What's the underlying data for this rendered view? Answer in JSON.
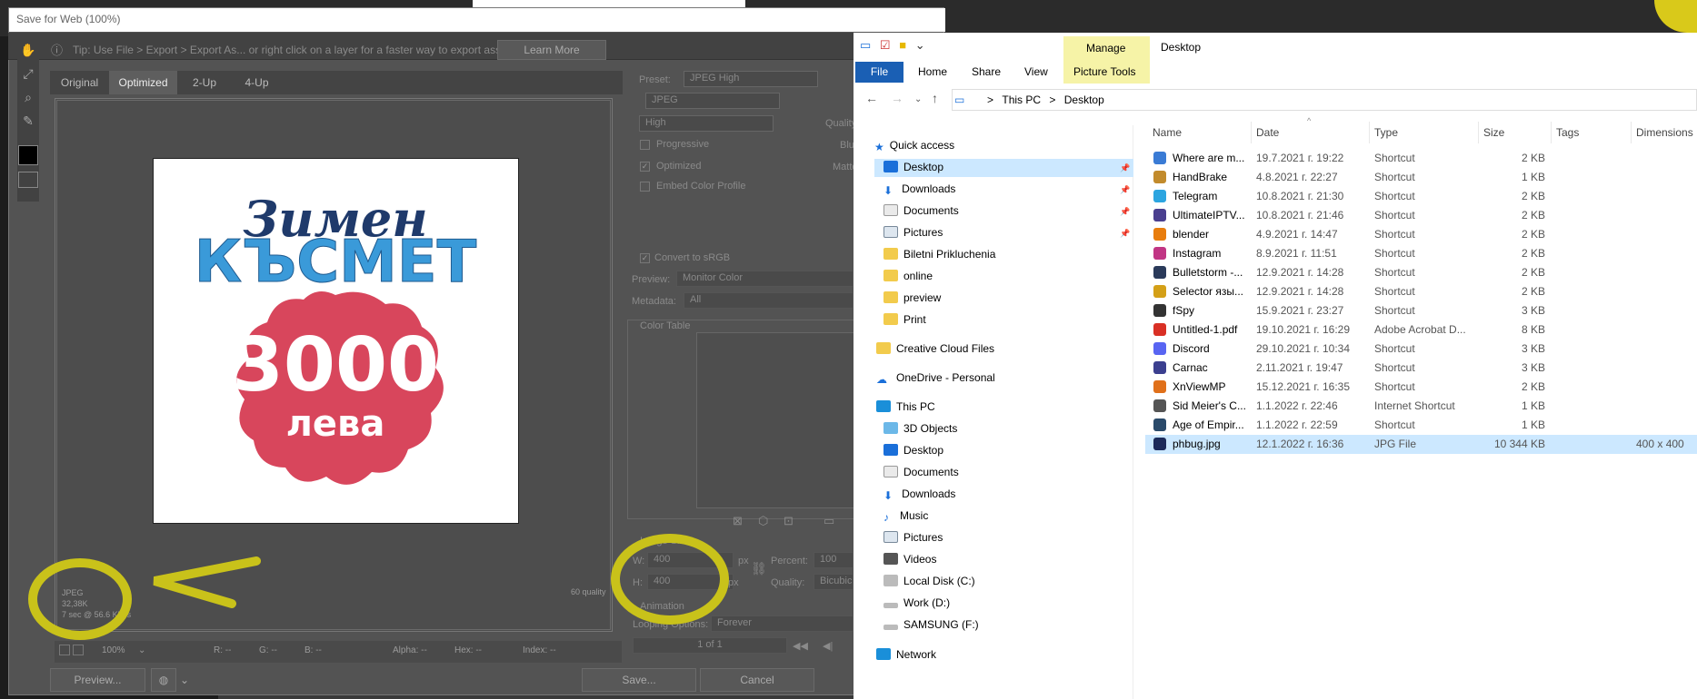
{
  "sfw": {
    "title": "Save for Web (100%)",
    "tip": "Tip: Use File > Export > Export As...  or right click on a layer for a faster way to export assets",
    "learn_more": "Learn More",
    "tabs": [
      "Original",
      "Optimized",
      "2-Up",
      "4-Up"
    ],
    "image_text": {
      "line1": "Зимен",
      "line2": "КЪСМЕТ",
      "amount": "3000",
      "currency": "лева"
    },
    "img_info": {
      "format": "JPEG",
      "size": "32,38K",
      "time": "7 sec @ 56.6 Kbps"
    },
    "quality_info": "60 quality",
    "status": {
      "zoom": "100%",
      "r": "R: --",
      "g": "G: --",
      "b": "B: --",
      "alpha": "Alpha: --",
      "hex": "Hex: --",
      "index": "Index: --"
    },
    "buttons": {
      "preview": "Preview...",
      "save": "Save...",
      "cancel": "Cancel"
    },
    "settings": {
      "preset_label": "Preset:",
      "preset_value": "JPEG High",
      "format": "JPEG",
      "quality_level": "High",
      "quality_label": "Quality:",
      "blur_label": "Blur:",
      "matte_label": "Matte:",
      "progressive": "Progressive",
      "optimized": "Optimized",
      "embed_profile": "Embed Color Profile",
      "convert_srgb": "Convert to sRGB",
      "preview_label": "Preview:",
      "preview_value": "Monitor Color",
      "metadata_label": "Metadata:",
      "metadata_value": "All",
      "color_table": "Color Table",
      "image_size": "Image Size",
      "w_label": "W:",
      "w_value": "400",
      "h_label": "H:",
      "h_value": "400",
      "px": "px",
      "percent_label": "Percent:",
      "percent_value": "100",
      "quality2_label": "Quality:",
      "quality2_value": "Bicubic",
      "animation": "Animation",
      "looping_label": "Looping Options:",
      "looping_value": "Forever",
      "frame": "1 of 1"
    }
  },
  "explorer": {
    "ribbon": {
      "manage": "Manage",
      "title": "Desktop",
      "picture_tools": "Picture Tools",
      "tabs": [
        "File",
        "Home",
        "Share",
        "View"
      ]
    },
    "address": {
      "pc": "This PC",
      "sep": ">",
      "folder": "Desktop"
    },
    "nav": {
      "quick_access": "Quick access",
      "desktop": "Desktop",
      "downloads": "Downloads",
      "documents": "Documents",
      "pictures": "Pictures",
      "biletni": "Biletni Prikluchenia",
      "online": "online",
      "preview": "preview",
      "print": "Print",
      "creative_cloud": "Creative Cloud Files",
      "onedrive": "OneDrive - Personal",
      "this_pc": "This PC",
      "objects3d": "3D Objects",
      "pc_desktop": "Desktop",
      "pc_documents": "Documents",
      "pc_downloads": "Downloads",
      "music": "Music",
      "pc_pictures": "Pictures",
      "videos": "Videos",
      "local_disk": "Local Disk (C:)",
      "work": "Work (D:)",
      "samsung": "SAMSUNG (F:)",
      "network": "Network"
    },
    "columns": [
      "Name",
      "Date",
      "Type",
      "Size",
      "Tags",
      "Dimensions"
    ],
    "files": [
      {
        "name": "Where are m...",
        "date": "19.7.2021 г. 19:22",
        "type": "Shortcut",
        "size": "2 KB",
        "dims": "",
        "color": "#3a7bd5"
      },
      {
        "name": "HandBrake",
        "date": "4.8.2021 г. 22:27",
        "type": "Shortcut",
        "size": "1 KB",
        "dims": "",
        "color": "#c28b2c"
      },
      {
        "name": "Telegram",
        "date": "10.8.2021 г. 21:30",
        "type": "Shortcut",
        "size": "2 KB",
        "dims": "",
        "color": "#2ca5e0"
      },
      {
        "name": "UltimateIPTV...",
        "date": "10.8.2021 г. 21:46",
        "type": "Shortcut",
        "size": "2 KB",
        "dims": "",
        "color": "#4a3f8f"
      },
      {
        "name": "blender",
        "date": "4.9.2021 г. 14:47",
        "type": "Shortcut",
        "size": "2 KB",
        "dims": "",
        "color": "#e87d0d"
      },
      {
        "name": "Instagram",
        "date": "8.9.2021 г. 11:51",
        "type": "Shortcut",
        "size": "2 KB",
        "dims": "",
        "color": "#c13584"
      },
      {
        "name": "Bulletstorm -...",
        "date": "12.9.2021 г. 14:28",
        "type": "Shortcut",
        "size": "2 KB",
        "dims": "",
        "color": "#2a3a5a"
      },
      {
        "name": "Selector язы...",
        "date": "12.9.2021 г. 14:28",
        "type": "Shortcut",
        "size": "2 KB",
        "dims": "",
        "color": "#d4a017"
      },
      {
        "name": "fSpy",
        "date": "15.9.2021 г. 23:27",
        "type": "Shortcut",
        "size": "3 KB",
        "dims": "",
        "color": "#333333"
      },
      {
        "name": "Untitled-1.pdf",
        "date": "19.10.2021 г. 16:29",
        "type": "Adobe Acrobat D...",
        "size": "8 KB",
        "dims": "",
        "color": "#d93025"
      },
      {
        "name": "Discord",
        "date": "29.10.2021 г. 10:34",
        "type": "Shortcut",
        "size": "3 KB",
        "dims": "",
        "color": "#5865f2"
      },
      {
        "name": "Carnac",
        "date": "2.11.2021 г. 19:47",
        "type": "Shortcut",
        "size": "3 KB",
        "dims": "",
        "color": "#3b3f8f"
      },
      {
        "name": "XnViewMP",
        "date": "15.12.2021 г. 16:35",
        "type": "Shortcut",
        "size": "2 KB",
        "dims": "",
        "color": "#e0701a"
      },
      {
        "name": "Sid Meier's C...",
        "date": "1.1.2022 г. 22:46",
        "type": "Internet Shortcut",
        "size": "1 KB",
        "dims": "",
        "color": "#555555"
      },
      {
        "name": "Age of Empir...",
        "date": "1.1.2022 г. 22:59",
        "type": "Shortcut",
        "size": "1 KB",
        "dims": "",
        "color": "#2a4a6a"
      },
      {
        "name": "phbug.jpg",
        "date": "12.1.2022 г. 16:36",
        "type": "JPG File",
        "size": "10 344 KB",
        "dims": "400 x 400",
        "color": "#1c2a5a"
      }
    ]
  },
  "colors": {
    "accent_blue": "#1a5fb4",
    "manage_yellow": "#f6f3a7",
    "select_blue": "#cce8ff",
    "annot_yellow": "#c9c21a",
    "annot_red": "#f07070",
    "badge_red": "#d8465c"
  }
}
